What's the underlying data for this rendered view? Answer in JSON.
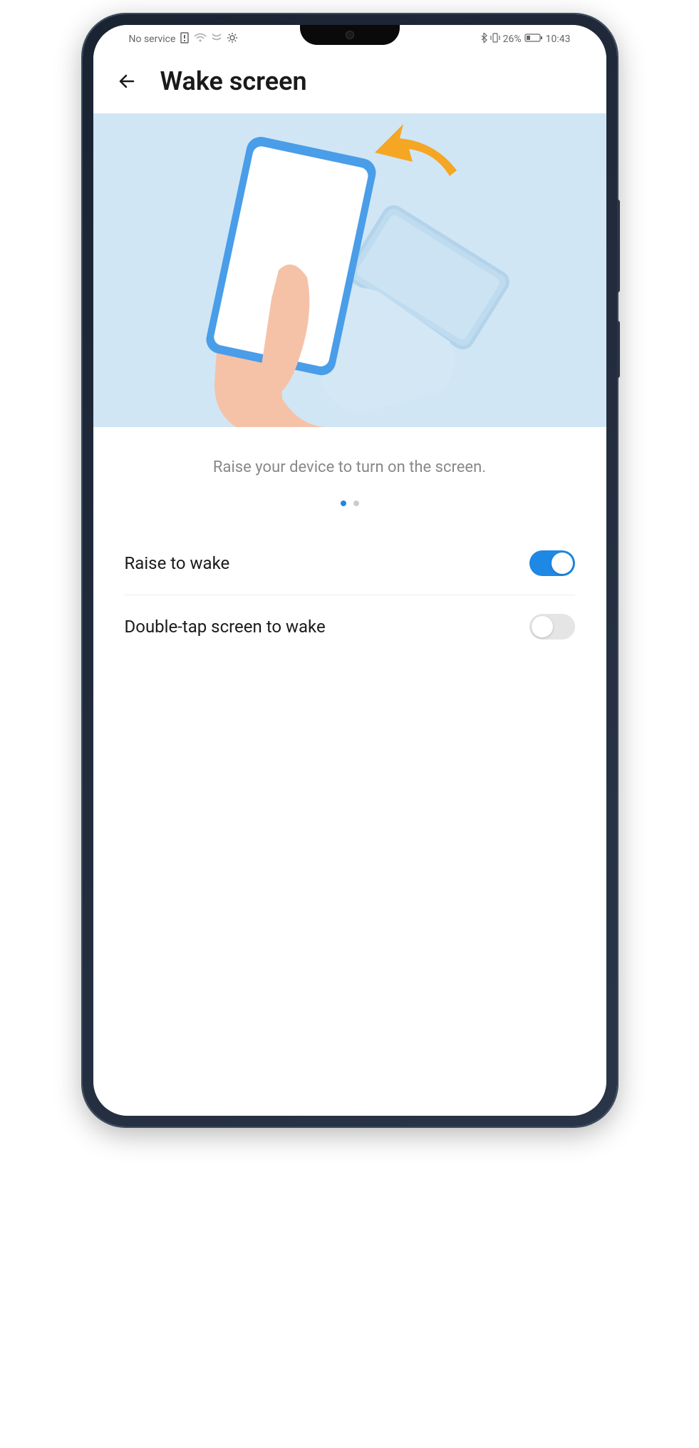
{
  "statusbar": {
    "left_text": "No service",
    "battery_percent": "26%",
    "time": "10:43"
  },
  "header": {
    "title": "Wake screen"
  },
  "caption": "Raise your device to turn on the screen.",
  "pager": {
    "current": 0,
    "total": 2
  },
  "settings": [
    {
      "key": "raise_to_wake",
      "label": "Raise to wake",
      "enabled": true
    },
    {
      "key": "double_tap_wake",
      "label": "Double-tap screen to wake",
      "enabled": false
    }
  ]
}
